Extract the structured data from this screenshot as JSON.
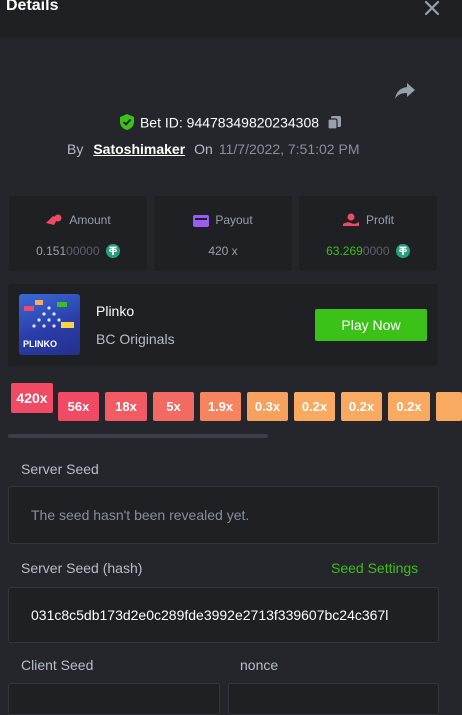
{
  "header": {
    "title": "Details"
  },
  "bet": {
    "id_label": "Bet ID: 94478349820234308"
  },
  "byline": {
    "by": "By",
    "user": "Satoshimaker",
    "on": "On",
    "date": "11/7/2022, 7:51:02 PM"
  },
  "stats": {
    "amount": {
      "label": "Amount",
      "value_main": "0.151",
      "value_dim": "00000"
    },
    "payout": {
      "label": "Payout",
      "value": "420 x"
    },
    "profit": {
      "label": "Profit",
      "value_main": "63.269",
      "value_dim": "0000"
    }
  },
  "game": {
    "name": "Plinko",
    "provider": "BC Originals",
    "play_label": "Play Now",
    "thumb_text": "PLINKO"
  },
  "multipliers": {
    "highlight": "420x",
    "items": [
      "56x",
      "18x",
      "5x",
      "1.9x",
      "0.3x",
      "0.2x",
      "0.2x",
      "0.2x"
    ]
  },
  "server_seed": {
    "label": "Server Seed",
    "value": "The seed hasn't been revealed yet."
  },
  "server_seed_hash": {
    "label": "Server Seed (hash)",
    "settings_label": "Seed Settings",
    "value": "031c8c5db173d2e0c289fde3992e2713f339607bc24c367l"
  },
  "client_seed": {
    "label": "Client Seed",
    "nonce_label": "nonce"
  },
  "colors": {
    "accent_green": "#3bc117",
    "multiplier_red": "#f04a65",
    "multiplier_orange": "#f6855f",
    "multiplier_amber": "#f9a960",
    "background": "#24262b",
    "card": "#1e2024"
  },
  "icons": [
    "close-icon",
    "share-icon",
    "shield-check-icon",
    "copy-icon",
    "coins-icon",
    "wallet-icon",
    "profit-hand-icon",
    "tether-icon"
  ]
}
